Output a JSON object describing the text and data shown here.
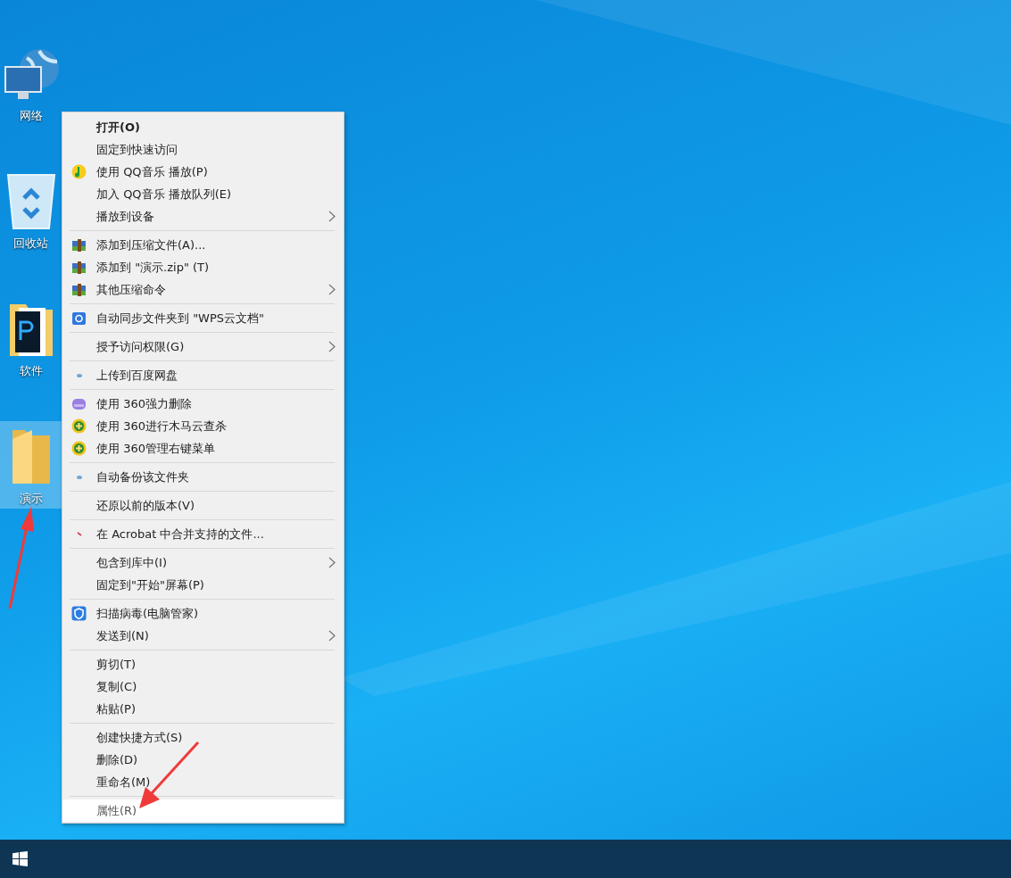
{
  "desktop_icons": [
    {
      "label": "网络",
      "kind": "network",
      "selected": false
    },
    {
      "label": "回收站",
      "kind": "recycle",
      "selected": false
    },
    {
      "label": "软件",
      "kind": "ps-folder",
      "selected": false
    },
    {
      "label": "演示",
      "kind": "folder",
      "selected": true
    }
  ],
  "context_menu": {
    "groups": [
      [
        {
          "label": "打开(O)",
          "bold": true,
          "selected": false
        },
        {
          "label": "固定到快速访问",
          "selected": false
        },
        {
          "label": "使用 QQ音乐 播放(P)",
          "kind": "music",
          "selected": false
        },
        {
          "label": "加入 QQ音乐 播放队列(E)",
          "selected": false
        },
        {
          "label": "播放到设备",
          "submenu": true,
          "selected": false
        }
      ],
      [
        {
          "label": "添加到压缩文件(A)...",
          "kind": "archive",
          "selected": false
        },
        {
          "label": "添加到 \"演示.zip\" (T)",
          "kind": "archive",
          "selected": false
        },
        {
          "label": "其他压缩命令",
          "kind": "archive",
          "submenu": true,
          "selected": false
        }
      ],
      [
        {
          "label": "自动同步文件夹到 \"WPS云文档\"",
          "kind": "cloud-folder",
          "selected": false
        }
      ],
      [
        {
          "label": "授予访问权限(G)",
          "submenu": true,
          "selected": false
        }
      ],
      [
        {
          "label": "上传到百度网盘",
          "kind": "dot",
          "selected": false
        }
      ],
      [
        {
          "label": "使用 360强力删除",
          "kind": "shredder",
          "selected": false
        },
        {
          "label": "使用 360进行木马云查杀",
          "kind": "plus-circle",
          "selected": false
        },
        {
          "label": "使用 360管理右键菜单",
          "kind": "plus-circle",
          "selected": false
        }
      ],
      [
        {
          "label": "自动备份该文件夹",
          "kind": "dot",
          "selected": false
        }
      ],
      [
        {
          "label": "还原以前的版本(V)",
          "selected": false
        }
      ],
      [
        {
          "label": "在 Acrobat 中合并支持的文件...",
          "kind": "red-mark",
          "selected": false
        }
      ],
      [
        {
          "label": "包含到库中(I)",
          "submenu": true,
          "selected": false
        },
        {
          "label": "固定到\"开始\"屏幕(P)",
          "selected": false
        }
      ],
      [
        {
          "label": "扫描病毒(电脑管家)",
          "kind": "shield",
          "selected": false
        },
        {
          "label": "发送到(N)",
          "submenu": true,
          "selected": false
        }
      ],
      [
        {
          "label": "剪切(T)",
          "selected": false
        },
        {
          "label": "复制(C)",
          "selected": false
        },
        {
          "label": "粘贴(P)",
          "selected": false
        }
      ],
      [
        {
          "label": "创建快捷方式(S)",
          "selected": false
        },
        {
          "label": "删除(D)",
          "selected": false
        },
        {
          "label": "重命名(M)",
          "selected": false
        }
      ],
      [
        {
          "label": "属性(R)",
          "selected": true
        }
      ]
    ]
  }
}
